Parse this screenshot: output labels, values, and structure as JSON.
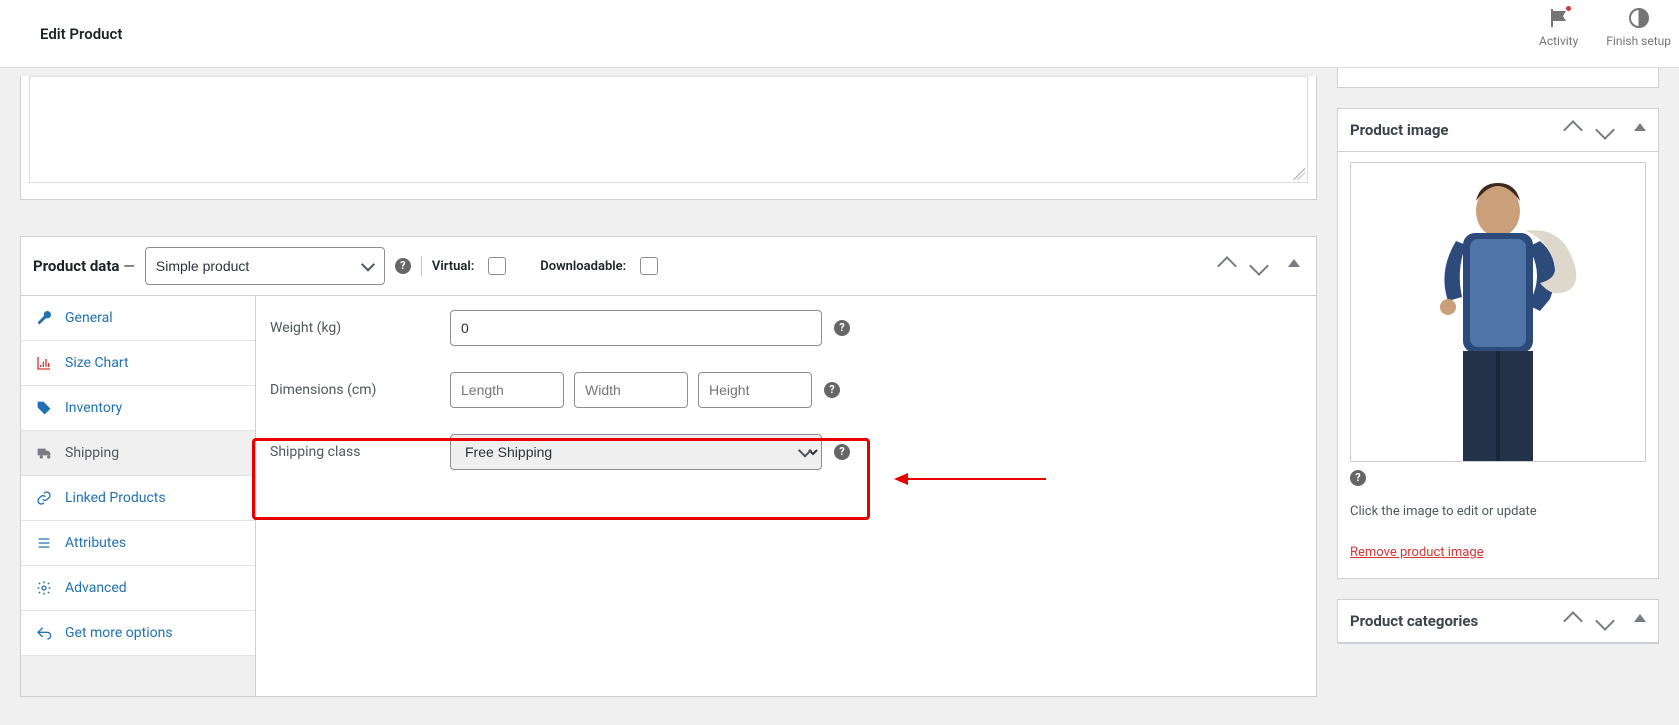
{
  "page_title": "Edit Product",
  "top_actions": {
    "activity": "Activity",
    "finish_setup": "Finish setup"
  },
  "product_data": {
    "heading": "Product data",
    "type_select": "Simple product",
    "virtual_label": "Virtual:",
    "downloadable_label": "Downloadable:",
    "tabs": {
      "general": "General",
      "size_chart": "Size Chart",
      "inventory": "Inventory",
      "shipping": "Shipping",
      "linked": "Linked Products",
      "attributes": "Attributes",
      "advanced": "Advanced",
      "get_more": "Get more options"
    },
    "shipping": {
      "weight_label": "Weight (kg)",
      "weight_value": "0",
      "dimensions_label": "Dimensions (cm)",
      "length_placeholder": "Length",
      "width_placeholder": "Width",
      "height_placeholder": "Height",
      "class_label": "Shipping class",
      "class_value": "Free Shipping"
    }
  },
  "sidebar": {
    "product_image": {
      "title": "Product image",
      "hint": "Click the image to edit or update",
      "remove": "Remove product image"
    },
    "product_categories": {
      "title": "Product categories"
    }
  }
}
